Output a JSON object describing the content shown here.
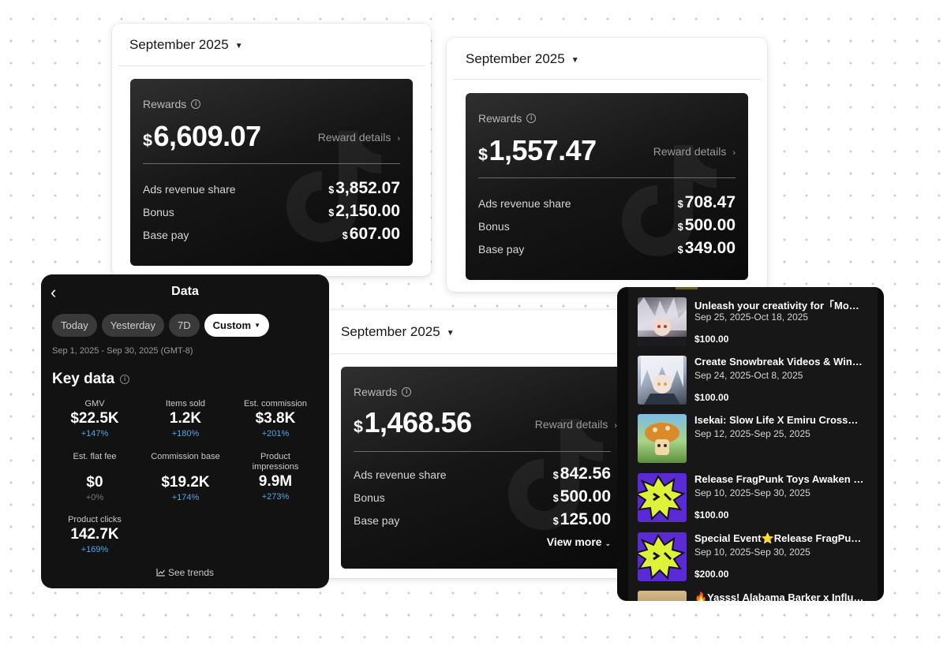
{
  "cards": [
    {
      "month": "September 2025",
      "rewards_label": "Rewards",
      "currency": "$",
      "total": "6,609.07",
      "details_label": "Reward details",
      "rows": [
        {
          "label": "Ads revenue share",
          "value": "3,852.07"
        },
        {
          "label": "Bonus",
          "value": "2,150.00"
        },
        {
          "label": "Base pay",
          "value": "607.00"
        }
      ]
    },
    {
      "month": "September 2025",
      "rewards_label": "Rewards",
      "currency": "$",
      "total": "1,557.47",
      "details_label": "Reward details",
      "rows": [
        {
          "label": "Ads revenue share",
          "value": "708.47"
        },
        {
          "label": "Bonus",
          "value": "500.00"
        },
        {
          "label": "Base pay",
          "value": "349.00"
        }
      ]
    },
    {
      "month": "September 2025",
      "rewards_label": "Rewards",
      "currency": "$",
      "total": "1,468.56",
      "details_label": "Reward details",
      "rows": [
        {
          "label": "Ads revenue share",
          "value": "842.56"
        },
        {
          "label": "Bonus",
          "value": "500.00"
        },
        {
          "label": "Base pay",
          "value": "125.00"
        }
      ],
      "view_more": "View more"
    }
  ],
  "data_panel": {
    "title": "Data",
    "chips": [
      "Today",
      "Yesterday",
      "7D",
      "Custom"
    ],
    "range": "Sep 1, 2025 - Sep 30, 2025 (GMT-8)",
    "key_data": "Key data",
    "metrics": [
      {
        "label": "GMV",
        "value": "$22.5K",
        "delta": "+147%"
      },
      {
        "label": "Items sold",
        "value": "1.2K",
        "delta": "+180%"
      },
      {
        "label": "Est. commission",
        "value": "$3.8K",
        "delta": "+201%"
      },
      {
        "label": "Est. flat fee",
        "value": "$0",
        "delta": "+0%"
      },
      {
        "label": "Commission base",
        "value": "$19.2K",
        "delta": "+174%"
      },
      {
        "label": "Product impressions",
        "value": "9.9M",
        "delta": "+273%"
      },
      {
        "label": "Product clicks",
        "value": "142.7K",
        "delta": "+169%"
      }
    ],
    "see_trends": "See trends"
  },
  "campaigns": [
    {
      "title": "Unleash your creativity for「Mon…",
      "dates": "Sep 25, 2025-Oct 18, 2025",
      "amount": "$100.00",
      "thumb": "anime-silver-hair"
    },
    {
      "title": "Create Snowbreak Videos & Win…",
      "dates": "Sep 24, 2025-Oct 8, 2025",
      "amount": "$100.00",
      "thumb": "anime-white-hair"
    },
    {
      "title": "Isekai: Slow Life X Emiru Crossov…",
      "dates": "Sep 12, 2025-Sep 25, 2025",
      "amount": "",
      "thumb": "mushroom-character"
    },
    {
      "title": "Release FragPunk Toys Awaken Vi…",
      "dates": "Sep 10, 2025-Sep 30, 2025",
      "amount": "$100.00",
      "thumb": "fragpunk-logo"
    },
    {
      "title": "Special Event⭐Release FragPun…",
      "dates": "Sep 10, 2025-Sep 30, 2025",
      "amount": "$200.00",
      "thumb": "fragpunk-logo"
    },
    {
      "title": "🔥Yasss! Alabama Barker x Influ…",
      "dates": "",
      "amount": "",
      "thumb": "event-photo"
    }
  ]
}
